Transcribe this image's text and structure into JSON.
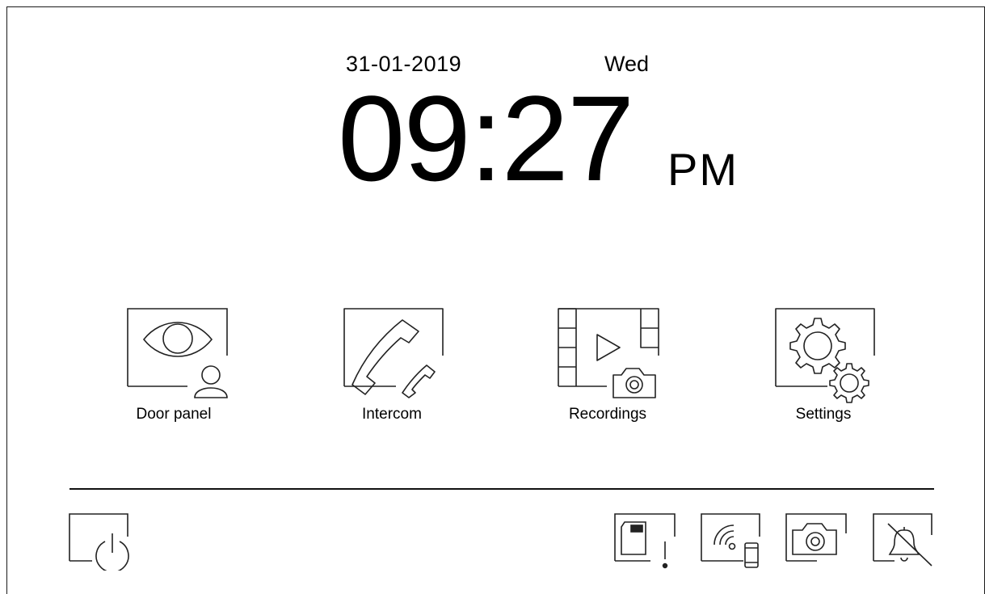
{
  "status": {
    "date": "31-01-2019",
    "weekday": "Wed",
    "time": "09:27",
    "ampm": "PM"
  },
  "menu": {
    "items": [
      {
        "label": "Door panel",
        "icon": "door-panel-icon"
      },
      {
        "label": "Intercom",
        "icon": "intercom-icon"
      },
      {
        "label": "Recordings",
        "icon": "recordings-icon"
      },
      {
        "label": "Settings",
        "icon": "settings-icon"
      }
    ]
  },
  "bottom_bar": {
    "icons": [
      "power-icon",
      "sd-card-alert-icon",
      "wifi-phone-icon",
      "camera-icon",
      "mute-bell-icon"
    ]
  },
  "colors": {
    "background": "#ffffff",
    "foreground": "#000000"
  }
}
